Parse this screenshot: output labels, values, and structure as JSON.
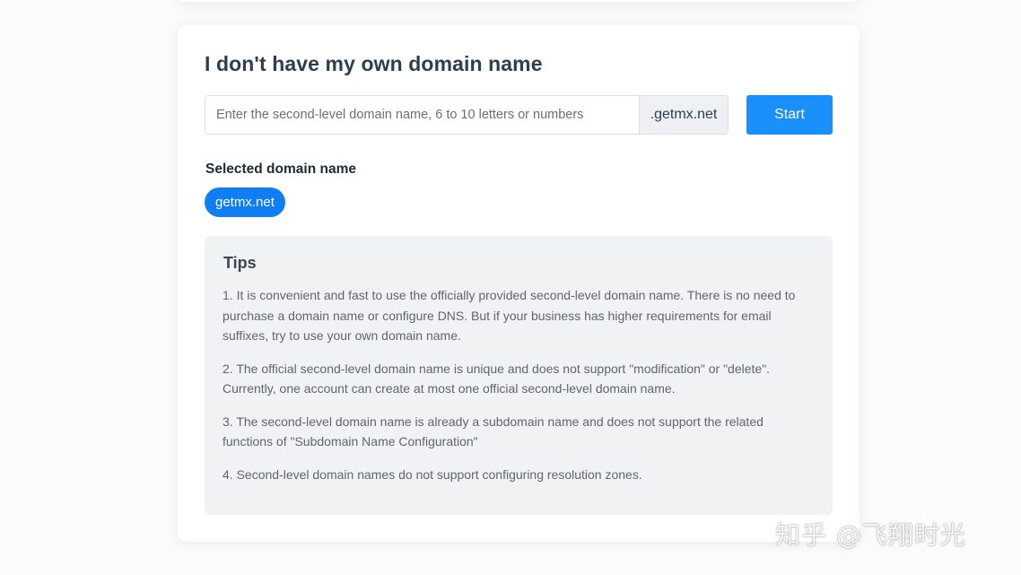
{
  "card": {
    "title": "I don't have my own domain name"
  },
  "domain_input": {
    "value": "",
    "placeholder": "Enter the second-level domain name, 6 to 10 letters or numbers",
    "suffix": ".getmx.net"
  },
  "start_button": {
    "label": "Start"
  },
  "selected": {
    "label": "Selected domain name",
    "chip": "getmx.net"
  },
  "tips": {
    "title": "Tips",
    "items": [
      "1. It is convenient and fast to use the officially provided second-level domain name. There is no need to purchase a domain name or configure DNS. But if your business has higher requirements for email suffixes, try to use your own domain name.",
      "2. The official second-level domain name is unique and does not support \"modification\" or \"delete\". Currently, one account can create at most one official second-level domain name.",
      "3. The second-level domain name is already a subdomain name and does not support the related functions of \"Subdomain Name Configuration\"",
      "4. Second-level domain names do not support configuring resolution zones."
    ]
  },
  "watermark": "知乎 @飞翔时光",
  "colors": {
    "accent": "#1b8ffb",
    "chip": "#0f7ef5",
    "tips_bg": "#f1f2f4"
  }
}
